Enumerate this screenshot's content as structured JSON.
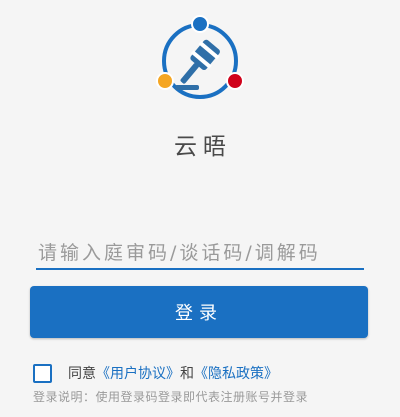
{
  "app": {
    "name": "云晤"
  },
  "login": {
    "code_placeholder": "请输入庭审码/谈话码/调解码",
    "code_value": "",
    "button_label": "登录"
  },
  "agreement": {
    "checked": false,
    "prefix": "同意",
    "user_agreement": "《用户协议》",
    "conjunction": "和",
    "privacy_policy": "《隐私政策》"
  },
  "note": "登录说明：使用登录码登录即代表注册账号并登录",
  "colors": {
    "accent": "#1a70c2",
    "logo_dot_top": "#1a70c2",
    "logo_dot_left": "#f5a623",
    "logo_dot_right": "#d0021b"
  },
  "icons": {
    "logo": "gavel-icon"
  }
}
